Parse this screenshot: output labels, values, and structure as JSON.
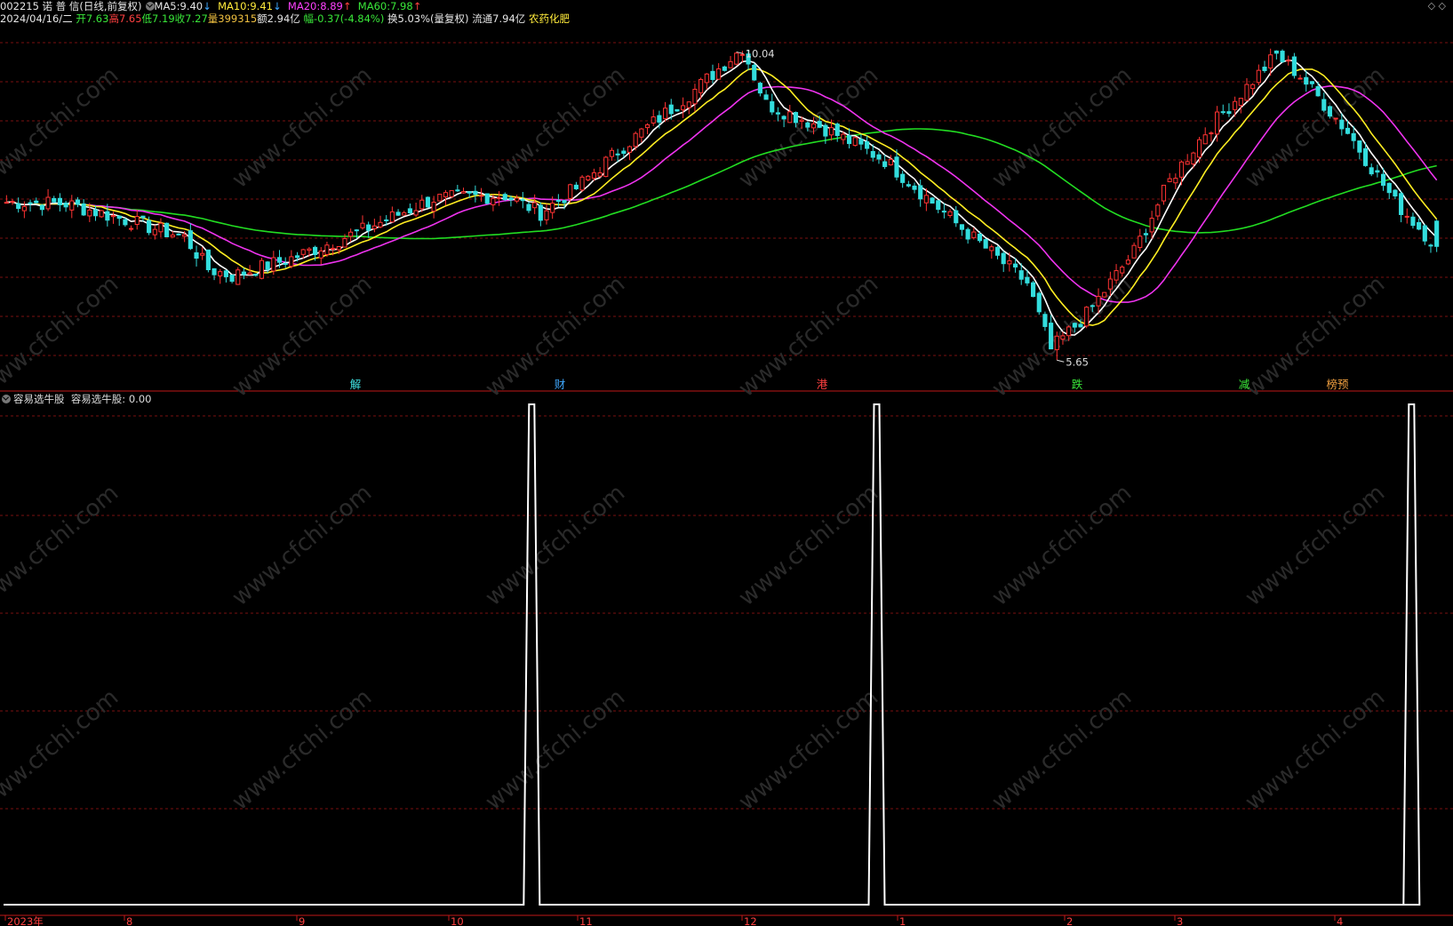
{
  "header": {
    "code_name": "002215 诺 普 信",
    "period": "(日线,前复权)",
    "ma5": {
      "label": "MA5:",
      "value": "9.40",
      "dir": "↓"
    },
    "ma10": {
      "label": "MA10:",
      "value": "9.41",
      "dir": "↓"
    },
    "ma20": {
      "label": "MA20:",
      "value": "8.89",
      "dir": "↑"
    },
    "ma60": {
      "label": "MA60:",
      "value": "7.98",
      "dir": "↑"
    },
    "date": "2024/04/16/二",
    "open_label": "开",
    "open": "7.63",
    "high_label": "高",
    "high": "7.65",
    "low_label": "低",
    "low": "7.19",
    "close_label": "收",
    "close": "7.27",
    "vol_label": "量",
    "vol": "399315",
    "amount_label": "额",
    "amount": "2.94亿",
    "chg_label": "幅",
    "chg": "-0.37(-4.84%)",
    "turnover": "换5.03%(量复权)",
    "float_cap": "流通7.94亿",
    "sector": "农药化肥"
  },
  "top_right": "◇ ◇",
  "indicator": {
    "name": "容易选牛股",
    "value_text": "容易选牛股: 0.00"
  },
  "x_axis": {
    "labels": [
      "2023年",
      "8",
      "9",
      "10",
      "11",
      "12",
      "1",
      "2",
      "3",
      "4"
    ]
  },
  "price_markers": {
    "high": "10.04",
    "low": "5.65"
  },
  "events": [
    {
      "text": "解",
      "color": "#3fe0e0"
    },
    {
      "text": "财",
      "color": "#3fa9ff"
    },
    {
      "text": "港",
      "color": "#ff4040"
    },
    {
      "text": "跌",
      "color": "#39e639"
    },
    {
      "text": "减",
      "color": "#39e639"
    },
    {
      "text": "榜预",
      "color": "#f0a040"
    }
  ],
  "watermark": "www.cfchi.com",
  "colors": {
    "up": "#ff3333",
    "down": "#33dddd",
    "ma5": "#ffffff",
    "ma10": "#ffee22",
    "ma20": "#ee33ee",
    "ma60": "#22dd22",
    "grid": "#7a1010",
    "indicator": "#ffffff"
  },
  "chart_data": [
    {
      "type": "candlestick",
      "ylim": [
        5.4,
        10.4
      ],
      "n_bars": 190,
      "anchors_close": [
        [
          0,
          7.9
        ],
        [
          10,
          7.88
        ],
        [
          20,
          7.65
        ],
        [
          30,
          7.4
        ],
        [
          34,
          6.95
        ],
        [
          38,
          6.85
        ],
        [
          48,
          7.1
        ],
        [
          60,
          7.5
        ],
        [
          72,
          7.95
        ],
        [
          84,
          8.0
        ],
        [
          90,
          7.75
        ],
        [
          96,
          8.1
        ],
        [
          104,
          8.7
        ],
        [
          116,
          9.5
        ],
        [
          124,
          10.1
        ],
        [
          128,
          9.3
        ],
        [
          138,
          8.95
        ],
        [
          148,
          8.5
        ],
        [
          160,
          7.6
        ],
        [
          172,
          6.75
        ],
        [
          176,
          5.8
        ],
        [
          182,
          6.3
        ],
        [
          190,
          7.2
        ],
        [
          196,
          8.2
        ],
        [
          202,
          8.9
        ],
        [
          214,
          10.0
        ],
        [
          218,
          9.7
        ],
        [
          226,
          8.9
        ],
        [
          234,
          7.9
        ],
        [
          241,
          7.27
        ]
      ],
      "high_value": 10.04,
      "low_value": 5.65,
      "last": {
        "open": 7.63,
        "high": 7.65,
        "low": 7.19,
        "close": 7.27
      }
    },
    {
      "type": "line",
      "title": "容易选牛股",
      "ylim": [
        0,
        1
      ],
      "series": [
        {
          "name": "容易选牛股",
          "spikes_at_fraction": [
            0.365,
            0.603,
            0.972
          ],
          "value_last": 0.0
        }
      ]
    }
  ]
}
